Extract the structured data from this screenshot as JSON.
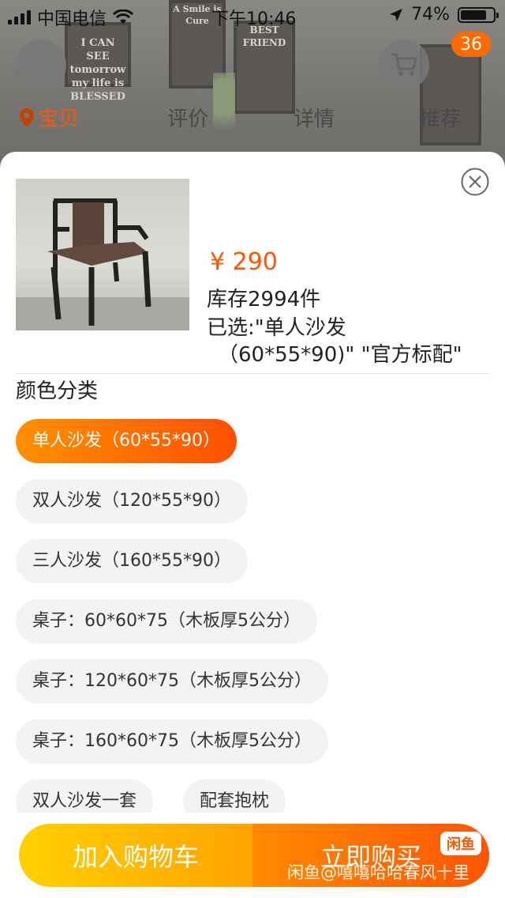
{
  "status_bar": {
    "carrier": "中国电信",
    "time": "下午10:46",
    "battery": "74%"
  },
  "background": {
    "frames": [
      "I CAN SEE tomorrow my life is BLESSED",
      "A Smile is Cure",
      "BEST FRIEND"
    ],
    "cart_badge": "36",
    "tabs": [
      "宝贝",
      "评价",
      "详情",
      "推荐"
    ]
  },
  "sku": {
    "price": "¥ 290",
    "stock": "库存2994件",
    "selected_line1": "已选:\"单人沙发",
    "selected_line2": "（60*55*90)\" \"官方标配\"",
    "section_title": "颜色分类",
    "options": [
      {
        "label": "单人沙发（60*55*90）",
        "selected": true
      },
      {
        "label": "双人沙发（120*55*90）",
        "selected": false
      },
      {
        "label": "三人沙发（160*55*90）",
        "selected": false
      },
      {
        "label": "桌子：60*60*75（木板厚5公分）",
        "selected": false
      },
      {
        "label": "桌子：120*60*75（木板厚5公分）",
        "selected": false
      },
      {
        "label": "桌子：160*60*75（木板厚5公分）",
        "selected": false
      },
      {
        "label": "双人沙发一套",
        "selected": false
      },
      {
        "label": "配套抱枕",
        "selected": false
      }
    ]
  },
  "footer": {
    "add_to_cart": "加入购物车",
    "buy_now": "立即购买"
  },
  "watermark": {
    "logo": "闲鱼",
    "text": "闲鱼@嘻嘻哈哈春风十里"
  },
  "colors": {
    "accent": "#ff5500",
    "cart_gradient": [
      "#ffd000",
      "#ffa300"
    ],
    "buy_gradient": [
      "#ff8a00",
      "#ff5500"
    ]
  }
}
